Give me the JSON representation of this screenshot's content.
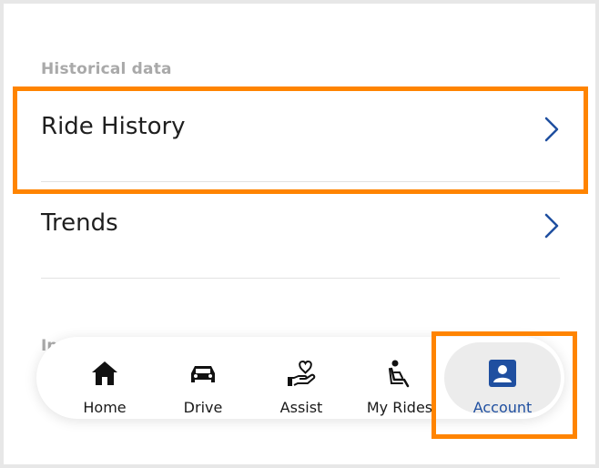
{
  "sections": {
    "historical_label": "Historical data",
    "partial_label": "In",
    "items": [
      {
        "label": "Ride History"
      },
      {
        "label": "Trends"
      }
    ]
  },
  "colors": {
    "highlight": "#ff8400",
    "chevron": "#1f4fa0",
    "active_tab": "#1f4fa0"
  },
  "nav": {
    "tabs": [
      {
        "label": "Home",
        "icon": "home-icon"
      },
      {
        "label": "Drive",
        "icon": "car-icon"
      },
      {
        "label": "Assist",
        "icon": "hand-heart-icon"
      },
      {
        "label": "My Rides",
        "icon": "car-seat-icon"
      },
      {
        "label": "Account",
        "icon": "account-icon",
        "active": true
      }
    ]
  }
}
